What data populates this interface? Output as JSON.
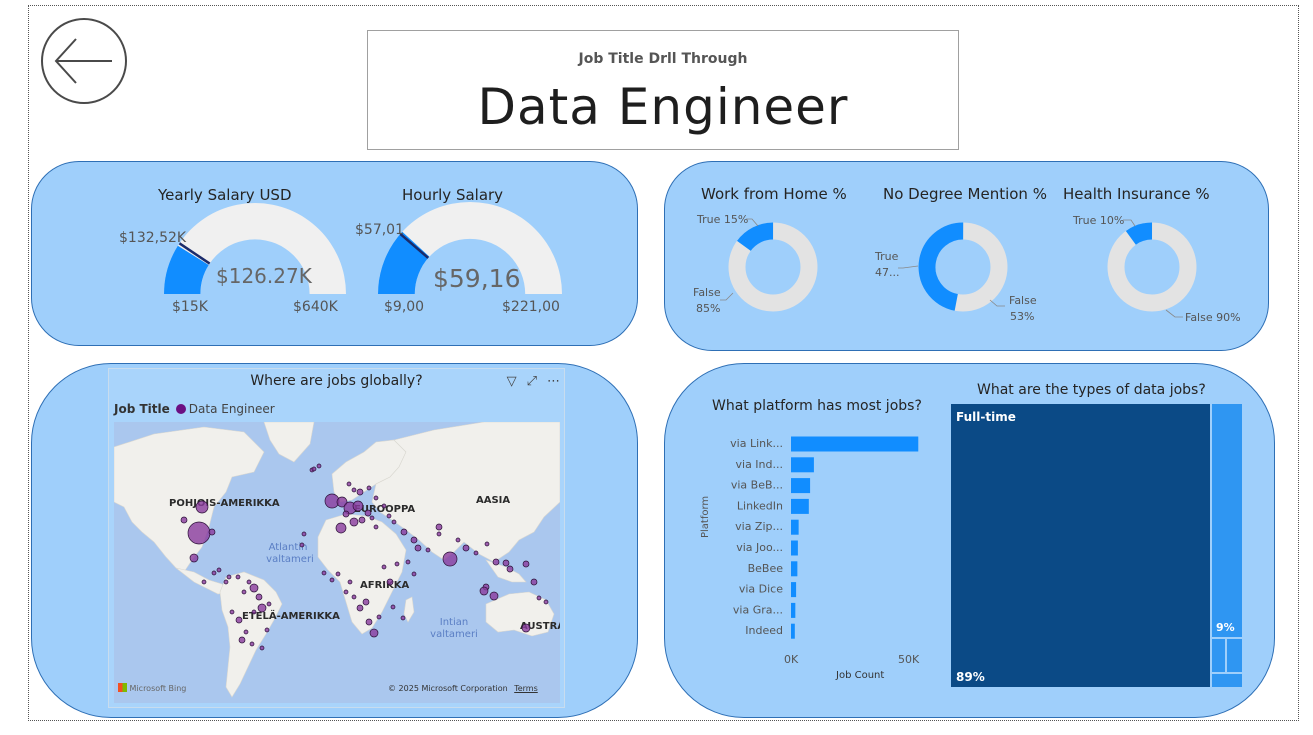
{
  "header": {
    "subtitle": "Job Title Drll Through",
    "title": "Data Engineer"
  },
  "kpis": {
    "yearly": {
      "title": "Yearly Salary USD",
      "value": "$126.27K",
      "min": "$15K",
      "max": "$640K",
      "target": "$132,52K",
      "value_num": 126.27,
      "min_num": 15,
      "max_num": 640,
      "target_num": 132.52
    },
    "hourly": {
      "title": "Hourly Salary",
      "value": "$59,16",
      "min": "$9,00",
      "max": "$221,00",
      "target": "$57,01",
      "value_num": 59.16,
      "min_num": 9,
      "max_num": 221,
      "target_num": 57.01
    }
  },
  "donuts": {
    "wfh": {
      "title": "Work from Home %",
      "true_label": "True 15%",
      "false_label_1": "False",
      "false_label_2": "85%",
      "true_pct": 15
    },
    "degree": {
      "title": "No Degree Mention %",
      "true_label_1": "True",
      "true_label_2": "47...",
      "false_label_1": "False",
      "false_label_2": "53%",
      "true_pct": 47
    },
    "health": {
      "title": "Health Insurance %",
      "true_label": "True 10%",
      "false_label": "False 90%",
      "true_pct": 10
    }
  },
  "map": {
    "title": "Where are jobs globally?",
    "legend_title": "Job Title",
    "legend_item": "Data Engineer",
    "labels": {
      "north_america": "POHJOIS-AMERIKKA",
      "europe": "EUROOPPA",
      "asia": "AASIA",
      "atlantic_1": "Atlantin",
      "atlantic_2": "valtameri",
      "africa": "AFRIKKA",
      "south_america": "ETELÄ-AMERIKKA",
      "indian_1": "Intian",
      "indian_2": "valtameri",
      "australia": "AUSTRA"
    },
    "bing": "Microsoft Bing",
    "copyright": "© 2025 Microsoft Corporation",
    "terms": "Terms"
  },
  "platforms_chart": {
    "title": "What platform has most jobs?",
    "ylabel": "Platform",
    "xlabel": "Job Count",
    "ticks": [
      "0K",
      "50K"
    ]
  },
  "types_chart": {
    "title": "What are the types of data jobs?",
    "main_label": "Full-time",
    "main_pct": "89%",
    "second_pct": "9%"
  },
  "chart_data": {
    "type": "bar",
    "orientation": "horizontal",
    "title": "What platform has most jobs?",
    "xlabel": "Job Count",
    "ylabel": "Platform",
    "categories": [
      "via Link...",
      "via Ind...",
      "via BeB...",
      "LinkedIn",
      "via Zip...",
      "via Joo...",
      "BeBee",
      "via Dice",
      "via Gra...",
      "Indeed"
    ],
    "values": [
      50000,
      9000,
      7500,
      7000,
      3000,
      2700,
      2500,
      2000,
      1700,
      1500
    ],
    "xlim": [
      0,
      55000
    ],
    "color": "#118dff"
  },
  "colors": {
    "accent": "#118dff",
    "panel": "#9fcffb",
    "treemap_main": "#0b4a86",
    "treemap_second": "#2f96f2",
    "marker": "#8a3b9e"
  }
}
